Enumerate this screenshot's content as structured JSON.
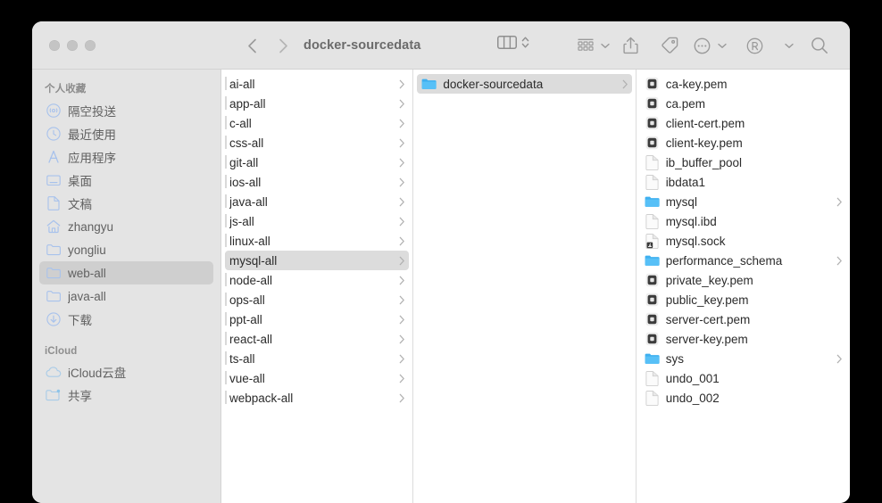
{
  "window": {
    "title": "docker-sourcedata",
    "traffic_lights": [
      "close",
      "minimize",
      "zoom"
    ],
    "chrome_color": "#e4e4e4",
    "accent_folder_color": "#48b0f0"
  },
  "toolbar": {
    "back_label": "Back",
    "forward_label": "Forward",
    "view_mode_label": "Column View",
    "view_mode_stepper_label": "View options",
    "group_label": "Group items",
    "share_label": "Share",
    "tag_label": "Edit Tags",
    "more_label": "More",
    "account_label": "Account",
    "search_label": "Search"
  },
  "sidebar": {
    "sections": [
      {
        "title": "个人收藏",
        "items": [
          {
            "label": "隔空投送",
            "icon": "airdrop-icon",
            "selected": false
          },
          {
            "label": "最近使用",
            "icon": "clock-icon",
            "selected": false
          },
          {
            "label": "应用程序",
            "icon": "applications-icon",
            "selected": false
          },
          {
            "label": "桌面",
            "icon": "desktop-icon",
            "selected": false
          },
          {
            "label": "文稿",
            "icon": "document-icon",
            "selected": false
          },
          {
            "label": "zhangyu",
            "icon": "home-icon",
            "selected": false
          },
          {
            "label": "yongliu",
            "icon": "folder-icon",
            "selected": false
          },
          {
            "label": "web-all",
            "icon": "folder-icon",
            "selected": true
          },
          {
            "label": "java-all",
            "icon": "folder-icon",
            "selected": false
          },
          {
            "label": "下载",
            "icon": "downloads-icon",
            "selected": false
          }
        ]
      },
      {
        "title": "iCloud",
        "items": [
          {
            "label": "iCloud云盘",
            "icon": "cloud-icon",
            "selected": false
          },
          {
            "label": "共享",
            "icon": "shared-folder-icon",
            "selected": false
          }
        ]
      }
    ]
  },
  "columns": [
    {
      "name": "column-one",
      "items": [
        {
          "label": "ai-all",
          "icon": "none",
          "chevron": true,
          "selected": false
        },
        {
          "label": "app-all",
          "icon": "none",
          "chevron": true,
          "selected": false
        },
        {
          "label": "c-all",
          "icon": "none",
          "chevron": true,
          "selected": false
        },
        {
          "label": "css-all",
          "icon": "none",
          "chevron": true,
          "selected": false
        },
        {
          "label": "git-all",
          "icon": "none",
          "chevron": true,
          "selected": false
        },
        {
          "label": "ios-all",
          "icon": "none",
          "chevron": true,
          "selected": false
        },
        {
          "label": "java-all",
          "icon": "none",
          "chevron": true,
          "selected": false
        },
        {
          "label": "js-all",
          "icon": "none",
          "chevron": true,
          "selected": false
        },
        {
          "label": "linux-all",
          "icon": "none",
          "chevron": true,
          "selected": false
        },
        {
          "label": "mysql-all",
          "icon": "none",
          "chevron": true,
          "selected": true
        },
        {
          "label": "node-all",
          "icon": "none",
          "chevron": true,
          "selected": false
        },
        {
          "label": "ops-all",
          "icon": "none",
          "chevron": true,
          "selected": false
        },
        {
          "label": "ppt-all",
          "icon": "none",
          "chevron": true,
          "selected": false
        },
        {
          "label": "react-all",
          "icon": "none",
          "chevron": true,
          "selected": false
        },
        {
          "label": "ts-all",
          "icon": "none",
          "chevron": true,
          "selected": false
        },
        {
          "label": "vue-all",
          "icon": "none",
          "chevron": true,
          "selected": false
        },
        {
          "label": "webpack-all",
          "icon": "none",
          "chevron": true,
          "selected": false
        }
      ]
    },
    {
      "name": "column-two",
      "items": [
        {
          "label": "docker-sourcedata",
          "icon": "folder-icon",
          "chevron": true,
          "selected": true
        }
      ]
    },
    {
      "name": "column-three",
      "items": [
        {
          "label": "ca-key.pem",
          "icon": "certificate-icon",
          "chevron": false,
          "selected": false
        },
        {
          "label": "ca.pem",
          "icon": "certificate-icon",
          "chevron": false,
          "selected": false
        },
        {
          "label": "client-cert.pem",
          "icon": "certificate-icon",
          "chevron": false,
          "selected": false
        },
        {
          "label": "client-key.pem",
          "icon": "certificate-icon",
          "chevron": false,
          "selected": false
        },
        {
          "label": "ib_buffer_pool",
          "icon": "file-icon",
          "chevron": false,
          "selected": false
        },
        {
          "label": "ibdata1",
          "icon": "file-icon",
          "chevron": false,
          "selected": false
        },
        {
          "label": "mysql",
          "icon": "folder-icon",
          "chevron": true,
          "selected": false
        },
        {
          "label": "mysql.ibd",
          "icon": "file-icon",
          "chevron": false,
          "selected": false
        },
        {
          "label": "mysql.sock",
          "icon": "socket-file-icon",
          "chevron": false,
          "selected": false
        },
        {
          "label": "performance_schema",
          "icon": "folder-icon",
          "chevron": true,
          "selected": false
        },
        {
          "label": "private_key.pem",
          "icon": "certificate-icon",
          "chevron": false,
          "selected": false
        },
        {
          "label": "public_key.pem",
          "icon": "certificate-icon",
          "chevron": false,
          "selected": false
        },
        {
          "label": "server-cert.pem",
          "icon": "certificate-icon",
          "chevron": false,
          "selected": false
        },
        {
          "label": "server-key.pem",
          "icon": "certificate-icon",
          "chevron": false,
          "selected": false
        },
        {
          "label": "sys",
          "icon": "folder-icon",
          "chevron": true,
          "selected": false
        },
        {
          "label": "undo_001",
          "icon": "file-icon",
          "chevron": false,
          "selected": false
        },
        {
          "label": "undo_002",
          "icon": "file-icon",
          "chevron": false,
          "selected": false
        }
      ]
    }
  ]
}
